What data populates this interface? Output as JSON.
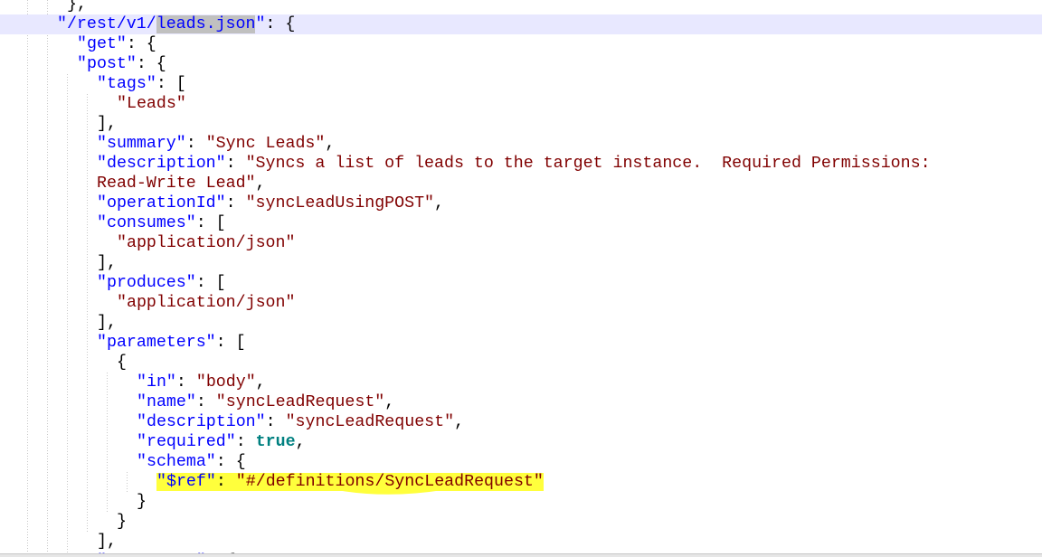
{
  "editor": {
    "lines": [
      {
        "indent": 4,
        "tokens": [
          {
            "t": "}",
            "c": "punct"
          },
          {
            "t": ",",
            "c": "punct"
          }
        ],
        "partial": true
      },
      {
        "indent": 3,
        "current": true,
        "tokens": [
          {
            "t": "\"/rest/v1/",
            "c": "key"
          },
          {
            "t": "leads.json",
            "c": "key",
            "sel": true
          },
          {
            "t": "\"",
            "c": "key"
          },
          {
            "t": ": {",
            "c": "punct"
          }
        ]
      },
      {
        "indent": 5,
        "tokens": [
          {
            "t": "\"get\"",
            "c": "key"
          },
          {
            "t": ": {",
            "c": "punct"
          }
        ]
      },
      {
        "indent": 5,
        "tokens": [
          {
            "t": "\"post\"",
            "c": "key"
          },
          {
            "t": ": {",
            "c": "punct"
          }
        ]
      },
      {
        "indent": 7,
        "tokens": [
          {
            "t": "\"tags\"",
            "c": "key"
          },
          {
            "t": ": [",
            "c": "punct"
          }
        ]
      },
      {
        "indent": 9,
        "tokens": [
          {
            "t": "\"Leads\"",
            "c": "str"
          }
        ]
      },
      {
        "indent": 7,
        "tokens": [
          {
            "t": "],",
            "c": "punct"
          }
        ]
      },
      {
        "indent": 7,
        "tokens": [
          {
            "t": "\"summary\"",
            "c": "key"
          },
          {
            "t": ": ",
            "c": "punct"
          },
          {
            "t": "\"Sync Leads\"",
            "c": "str"
          },
          {
            "t": ",",
            "c": "punct"
          }
        ]
      },
      {
        "indent": 7,
        "tokens": [
          {
            "t": "\"description\"",
            "c": "key"
          },
          {
            "t": ": ",
            "c": "punct"
          },
          {
            "t": "\"Syncs a list of leads to the target instance.  Required Permissions:",
            "c": "str"
          }
        ]
      },
      {
        "indent": 7,
        "tokens": [
          {
            "t": "Read-Write Lead\"",
            "c": "str"
          },
          {
            "t": ",",
            "c": "punct"
          }
        ]
      },
      {
        "indent": 7,
        "tokens": [
          {
            "t": "\"operationId\"",
            "c": "key"
          },
          {
            "t": ": ",
            "c": "punct"
          },
          {
            "t": "\"syncLeadUsingPOST\"",
            "c": "str"
          },
          {
            "t": ",",
            "c": "punct"
          }
        ]
      },
      {
        "indent": 7,
        "tokens": [
          {
            "t": "\"consumes\"",
            "c": "key"
          },
          {
            "t": ": [",
            "c": "punct"
          }
        ]
      },
      {
        "indent": 9,
        "tokens": [
          {
            "t": "\"application/json\"",
            "c": "str"
          }
        ]
      },
      {
        "indent": 7,
        "tokens": [
          {
            "t": "],",
            "c": "punct"
          }
        ]
      },
      {
        "indent": 7,
        "tokens": [
          {
            "t": "\"produces\"",
            "c": "key"
          },
          {
            "t": ": [",
            "c": "punct"
          }
        ]
      },
      {
        "indent": 9,
        "tokens": [
          {
            "t": "\"application/json\"",
            "c": "str"
          }
        ]
      },
      {
        "indent": 7,
        "tokens": [
          {
            "t": "],",
            "c": "punct"
          }
        ]
      },
      {
        "indent": 7,
        "tokens": [
          {
            "t": "\"parameters\"",
            "c": "key"
          },
          {
            "t": ": [",
            "c": "punct"
          }
        ]
      },
      {
        "indent": 9,
        "tokens": [
          {
            "t": "{",
            "c": "punct"
          }
        ]
      },
      {
        "indent": 11,
        "tokens": [
          {
            "t": "\"in\"",
            "c": "key"
          },
          {
            "t": ": ",
            "c": "punct"
          },
          {
            "t": "\"body\"",
            "c": "str"
          },
          {
            "t": ",",
            "c": "punct"
          }
        ]
      },
      {
        "indent": 11,
        "tokens": [
          {
            "t": "\"name\"",
            "c": "key"
          },
          {
            "t": ": ",
            "c": "punct"
          },
          {
            "t": "\"syncLeadRequest\"",
            "c": "str"
          },
          {
            "t": ",",
            "c": "punct"
          }
        ]
      },
      {
        "indent": 11,
        "tokens": [
          {
            "t": "\"description\"",
            "c": "key"
          },
          {
            "t": ": ",
            "c": "punct"
          },
          {
            "t": "\"syncLeadRequest\"",
            "c": "str"
          },
          {
            "t": ",",
            "c": "punct"
          }
        ]
      },
      {
        "indent": 11,
        "tokens": [
          {
            "t": "\"required\"",
            "c": "key"
          },
          {
            "t": ": ",
            "c": "punct"
          },
          {
            "t": "true",
            "c": "bool"
          },
          {
            "t": ",",
            "c": "punct"
          }
        ]
      },
      {
        "indent": 11,
        "tokens": [
          {
            "t": "\"schema\"",
            "c": "key"
          },
          {
            "t": ": {",
            "c": "punct"
          }
        ]
      },
      {
        "indent": 13,
        "tokens": [
          {
            "t": "\"$ref\"",
            "c": "key",
            "hl": true
          },
          {
            "t": ": ",
            "c": "punct",
            "hl": true
          },
          {
            "t": "\"#/definitions/SyncLeadRequest\"",
            "c": "str",
            "hl": true
          }
        ]
      },
      {
        "indent": 11,
        "tokens": [
          {
            "t": "}",
            "c": "punct"
          }
        ]
      },
      {
        "indent": 9,
        "tokens": [
          {
            "t": "}",
            "c": "punct"
          }
        ]
      },
      {
        "indent": 7,
        "tokens": [
          {
            "t": "],",
            "c": "punct"
          }
        ]
      },
      {
        "indent": 7,
        "tokens": [
          {
            "t": "\"responses\"",
            "c": "key"
          },
          {
            "t": ": {",
            "c": "punct"
          }
        ]
      }
    ]
  },
  "colors": {
    "key": "#0000ff",
    "string": "#800000",
    "boolean": "#008080",
    "punctuation": "#000000",
    "current_line": "#e8e8ff",
    "selection": "#c0c0c0",
    "highlight_marker": "#ffff3c",
    "indent_guide": "#c8c8c8"
  }
}
